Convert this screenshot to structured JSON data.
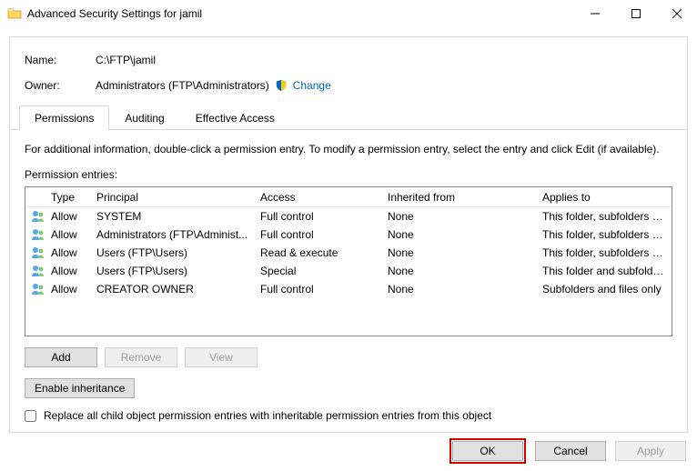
{
  "window": {
    "title": "Advanced Security Settings for jamil"
  },
  "info": {
    "name_label": "Name:",
    "name_value": "C:\\FTP\\jamil",
    "owner_label": "Owner:",
    "owner_value": "Administrators (FTP\\Administrators)",
    "change_link": "Change"
  },
  "tabs": {
    "permissions": "Permissions",
    "auditing": "Auditing",
    "effective": "Effective Access"
  },
  "body": {
    "hint": "For additional information, double-click a permission entry. To modify a permission entry, select the entry and click Edit (if available).",
    "list_label": "Permission entries:",
    "headers": {
      "type": "Type",
      "principal": "Principal",
      "access": "Access",
      "inherited": "Inherited from",
      "applies": "Applies to"
    },
    "entries": [
      {
        "type": "Allow",
        "principal": "SYSTEM",
        "access": "Full control",
        "inherited": "None",
        "applies": "This folder, subfolders and files"
      },
      {
        "type": "Allow",
        "principal": "Administrators (FTP\\Administ...",
        "access": "Full control",
        "inherited": "None",
        "applies": "This folder, subfolders and files"
      },
      {
        "type": "Allow",
        "principal": "Users (FTP\\Users)",
        "access": "Read & execute",
        "inherited": "None",
        "applies": "This folder, subfolders and files"
      },
      {
        "type": "Allow",
        "principal": "Users (FTP\\Users)",
        "access": "Special",
        "inherited": "None",
        "applies": "This folder and subfolders"
      },
      {
        "type": "Allow",
        "principal": "CREATOR OWNER",
        "access": "Full control",
        "inherited": "None",
        "applies": "Subfolders and files only"
      }
    ],
    "buttons": {
      "add": "Add",
      "remove": "Remove",
      "view": "View"
    },
    "enable_inheritance": "Enable inheritance",
    "replace_checkbox": "Replace all child object permission entries with inheritable permission entries from this object"
  },
  "dialog": {
    "ok": "OK",
    "cancel": "Cancel",
    "apply": "Apply"
  }
}
